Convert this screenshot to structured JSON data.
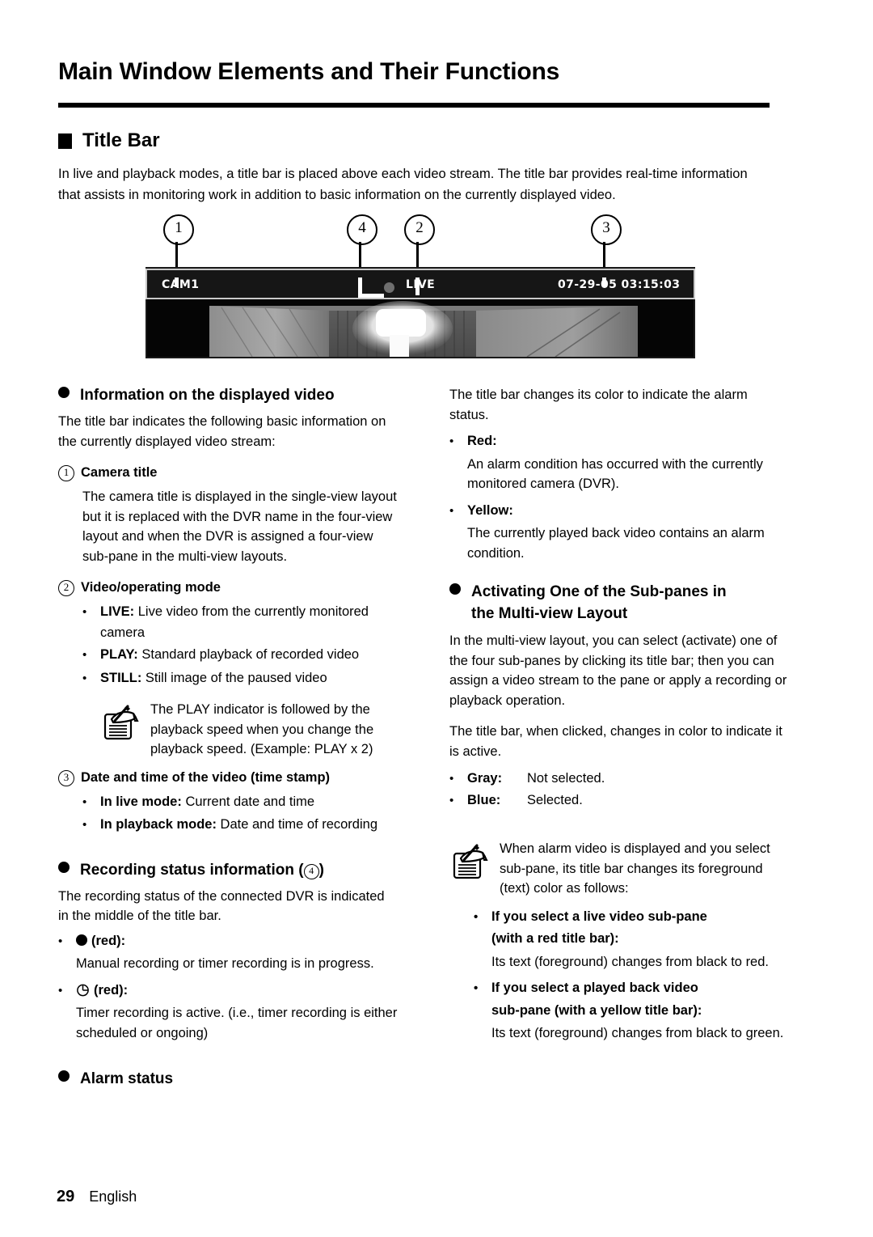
{
  "page": {
    "title": "Main Window Elements and Their Functions",
    "footer_page_number": "29",
    "footer_language": "English"
  },
  "section": {
    "heading": "Title Bar",
    "intro": "In live and playback modes, a title bar is placed above each video stream. The title bar provides real-time information that assists in monitoring work in addition to basic information on the currently displayed video."
  },
  "figure": {
    "callouts": [
      "1",
      "4",
      "2",
      "3"
    ],
    "titlebar": {
      "camera_title": "CAM1",
      "mode": "LIVE",
      "timestamp": "07-29-05 03:15:03",
      "rec_indicator": "recording-dot-icon",
      "bar_color": "#161616",
      "border_color": "#c9c9c9",
      "text_color": "#ffffff",
      "dot_color": "#6f6f6f"
    }
  },
  "left_column": {
    "info_heading": "Information on the displayed video",
    "info_para": "The title bar indicates the following basic information on the currently displayed video stream:",
    "item1": {
      "number": "1",
      "heading": "Camera title",
      "body": "The camera title is displayed in the single-view layout but it is replaced with the DVR name in the four-view layout and when the DVR is assigned a four-view sub-pane in the multi-view layouts."
    },
    "item2": {
      "number": "2",
      "heading": "Video/operating mode",
      "bullets": [
        {
          "term": "LIVE:",
          "desc": " Live video from the currently monitored camera"
        },
        {
          "term": "PLAY:",
          "desc": " Standard playback of recorded video"
        },
        {
          "term": "STILL:",
          "desc": " Still image of the paused video"
        }
      ],
      "note": "The PLAY indicator is followed by the playback speed when you change the playback speed. (Example: PLAY x 2)"
    },
    "item3": {
      "number": "3",
      "heading": "Date and time of the video (time stamp)",
      "bullets": [
        {
          "term": "In live mode:",
          "desc": " Current date and time"
        },
        {
          "term": "In playback mode:",
          "desc": " Date and time of recording"
        }
      ]
    },
    "recording_status": {
      "heading_prefix": "Recording status information (",
      "heading_number": "4",
      "heading_suffix": ")",
      "body": "The recording status of the connected DVR is indicated in the middle of the title bar.",
      "entries": [
        {
          "icon": "filled-circle-icon",
          "label": "(red):",
          "desc": "Manual recording or timer recording is in progress."
        },
        {
          "icon": "clock-icon",
          "label": "(red):",
          "desc": "Timer recording is active. (i.e., timer recording is either scheduled or ongoing)"
        }
      ]
    },
    "alarm_status_heading": "Alarm status"
  },
  "right_column": {
    "alarm_intro": "The title bar changes its color to indicate the alarm status.",
    "alarm_items": [
      {
        "term": "Red:",
        "desc": "An alarm condition has occurred with the currently monitored camera (DVR)."
      },
      {
        "term": "Yellow:",
        "desc": "The currently played back video contains an alarm condition."
      }
    ],
    "activating": {
      "heading_line1": "Activating One of the Sub-panes in",
      "heading_line2": "the Multi-view Layout",
      "para1": "In the multi-view layout, you can select (activate) one of the four sub-panes by clicking its title bar; then you can assign a video stream to the pane or apply a recording or playback operation.",
      "para2": "The title bar, when clicked, changes in color to indicate it is active.",
      "states": [
        {
          "key": "Gray:",
          "value": "Not selected."
        },
        {
          "key": "Blue:",
          "value": "Selected."
        }
      ],
      "note_intro": "When alarm video is displayed and you select sub-pane, its title bar changes its foreground (text) color as follows:",
      "note_items": [
        {
          "bold_line1": "If you select a live video sub-pane",
          "bold_line2": "(with a red title bar):",
          "body": "Its text (foreground) changes from black to red."
        },
        {
          "bold_line1": "If you select a played back video",
          "bold_line2": "sub-pane (with a yellow title bar):",
          "body": "Its text (foreground) changes from black to green."
        }
      ]
    }
  }
}
